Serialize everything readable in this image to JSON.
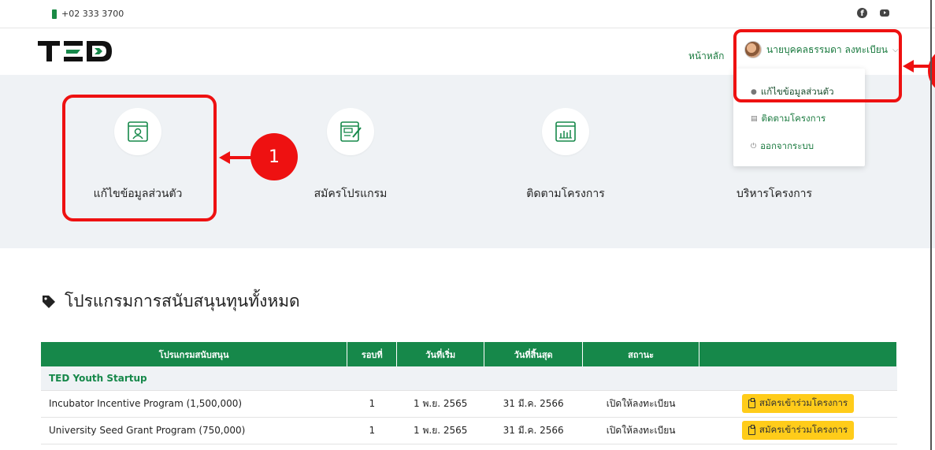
{
  "topbar": {
    "phone": "+02 333 3700",
    "icons": [
      "facebook-icon",
      "youtube-icon"
    ]
  },
  "header": {
    "logo_text": "TED",
    "home_link": "หน้าหลัก",
    "user_name": "นายบุคคลธรรมดา ลงทะเบียน"
  },
  "dropdown": {
    "items": [
      {
        "label": "แก้ไขข้อมูลส่วนตัว",
        "icon": "user-icon"
      },
      {
        "label": "ติดตามโครงการ",
        "icon": "list-icon"
      },
      {
        "label": "ออกจากระบบ",
        "icon": "power-icon"
      }
    ]
  },
  "tiles": [
    {
      "label": "แก้ไขข้อมูลส่วนตัว",
      "icon": "profile-icon"
    },
    {
      "label": "สมัครโปรแกรม",
      "icon": "form-edit-icon"
    },
    {
      "label": "ติดตามโครงการ",
      "icon": "chart-window-icon"
    },
    {
      "label": "บริหารโครงการ",
      "icon": "manage-icon"
    }
  ],
  "annotations": {
    "badge1": "1"
  },
  "section": {
    "title": "โปรแกรมการสนับสนุนทุนทั้งหมด"
  },
  "table": {
    "headers": [
      "โปรแกรมสนับสนุน",
      "รอบที่",
      "วันที่เริ่ม",
      "วันที่สิ้นสุด",
      "สถานะ",
      ""
    ],
    "group": "TED Youth Startup",
    "rows": [
      {
        "program": "Incubator Incentive Program (1,500,000)",
        "round": "1",
        "start": "1 พ.ย. 2565",
        "end": "31 มี.ค. 2566",
        "status": "เปิดให้ลงทะเบียน",
        "action": "สมัครเข้าร่วมโครงการ"
      },
      {
        "program": "University Seed Grant Program (750,000)",
        "round": "1",
        "start": "1 พ.ย. 2565",
        "end": "31 มี.ค. 2566",
        "status": "เปิดให้ลงทะเบียน",
        "action": "สมัครเข้าร่วมโครงการ"
      }
    ]
  },
  "colors": {
    "brand_green": "#16884a",
    "annotation_red": "#ee1111",
    "button_yellow": "#ffcc1a"
  }
}
